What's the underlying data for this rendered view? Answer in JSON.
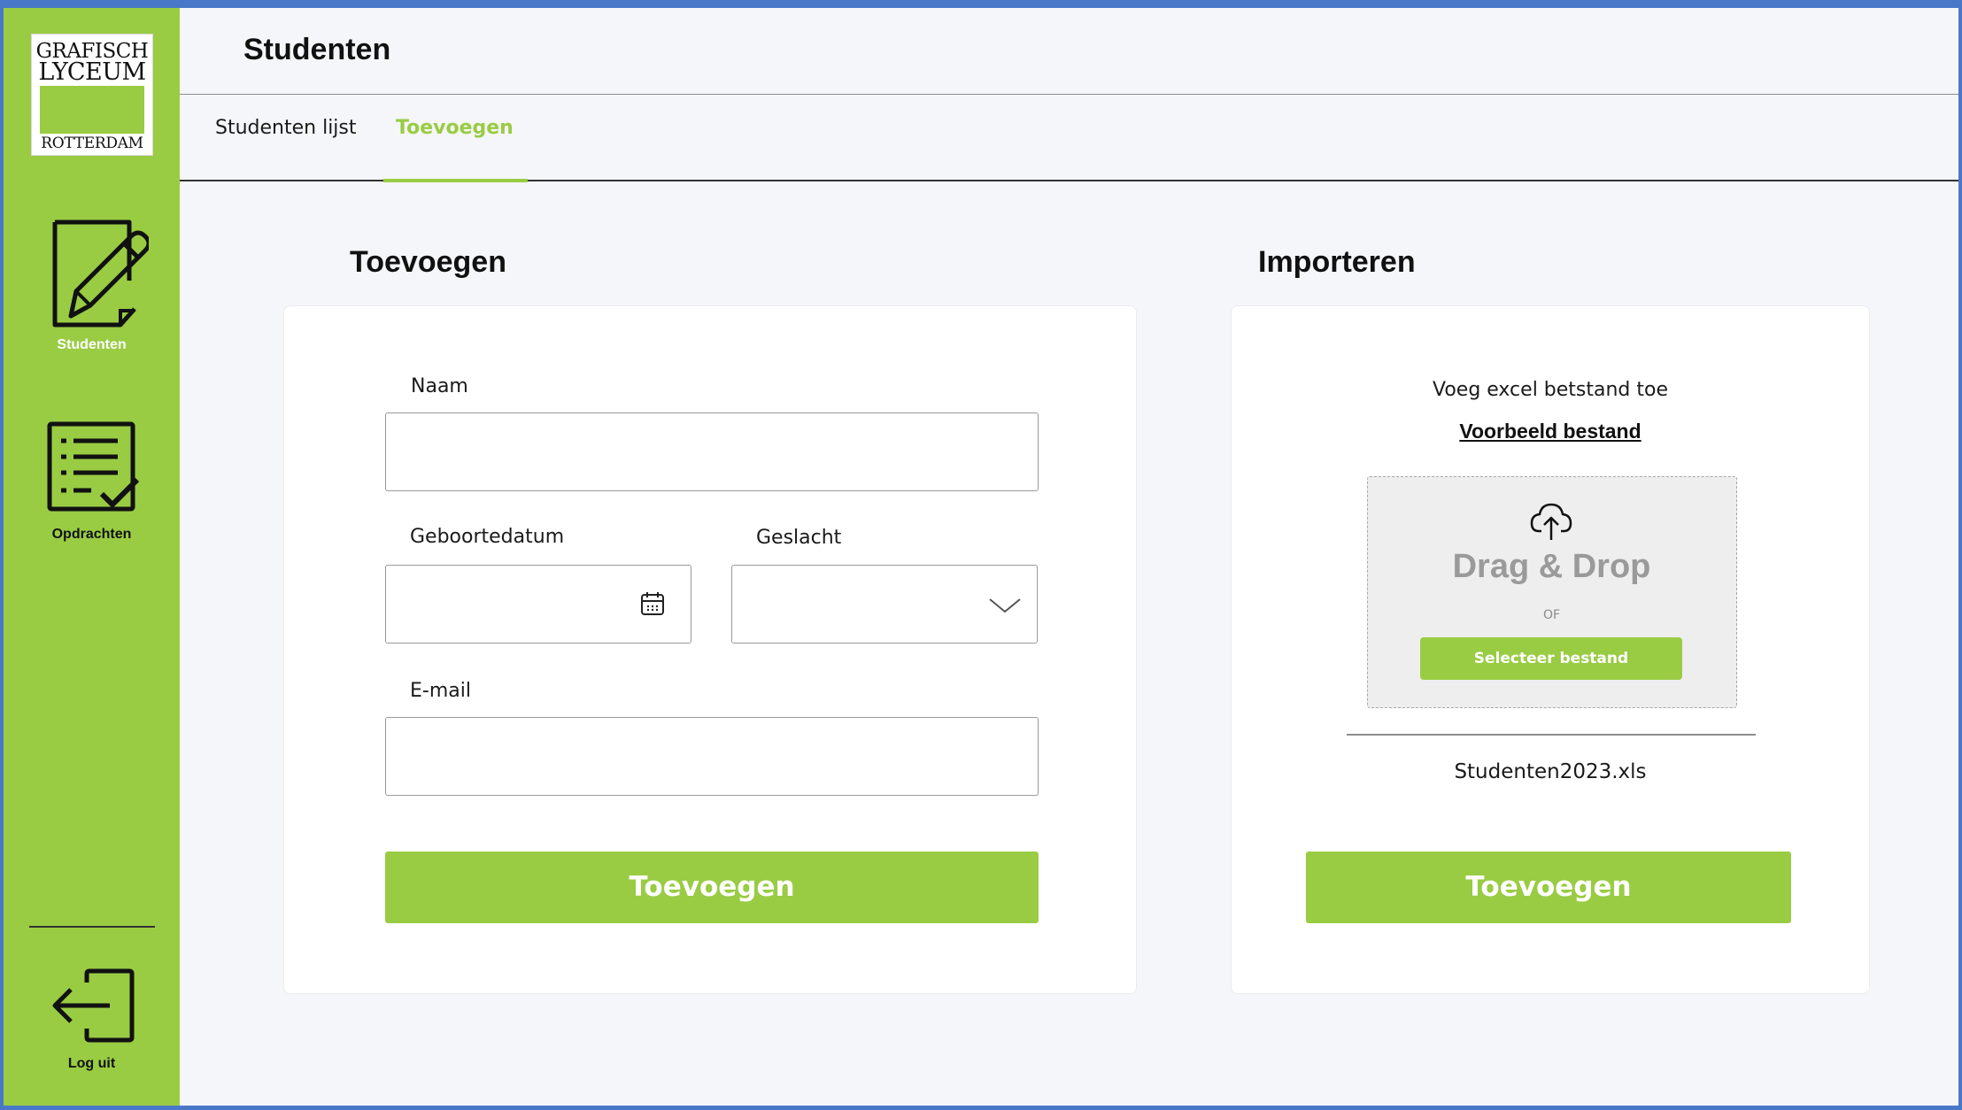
{
  "sidebar": {
    "logo": {
      "line1": "GRAFISCH",
      "line2": "LYCEUM",
      "line3": "ROTTERDAM"
    },
    "items": [
      {
        "label": "Studenten",
        "icon": "edit-document-icon"
      },
      {
        "label": "Opdrachten",
        "icon": "checklist-icon"
      }
    ],
    "logout_label": "Log uit",
    "logout_icon": "logout-icon"
  },
  "header": {
    "title": "Studenten"
  },
  "tabs": [
    {
      "label": "Studenten lijst",
      "active": false
    },
    {
      "label": "Toevoegen",
      "active": true
    }
  ],
  "form": {
    "title": "Toevoegen",
    "name_label": "Naam",
    "name_value": "",
    "birthdate_label": "Geboortedatum",
    "birthdate_value": "",
    "gender_label": "Geslacht",
    "gender_value": "",
    "email_label": "E-mail",
    "email_value": "",
    "submit_label": "Toevoegen"
  },
  "import": {
    "title": "Importeren",
    "hint": "Voeg excel betstand toe",
    "example_link": "Voorbeeld bestand",
    "dropzone_title": "Drag & Drop",
    "dropzone_or": "OF",
    "select_label": "Selecteer bestand",
    "file_name": "Studenten2023.xls",
    "submit_label": "Toevoegen"
  },
  "colors": {
    "accent": "#99cc43",
    "background": "#f5f6f9",
    "frame": "#4a78c8"
  }
}
